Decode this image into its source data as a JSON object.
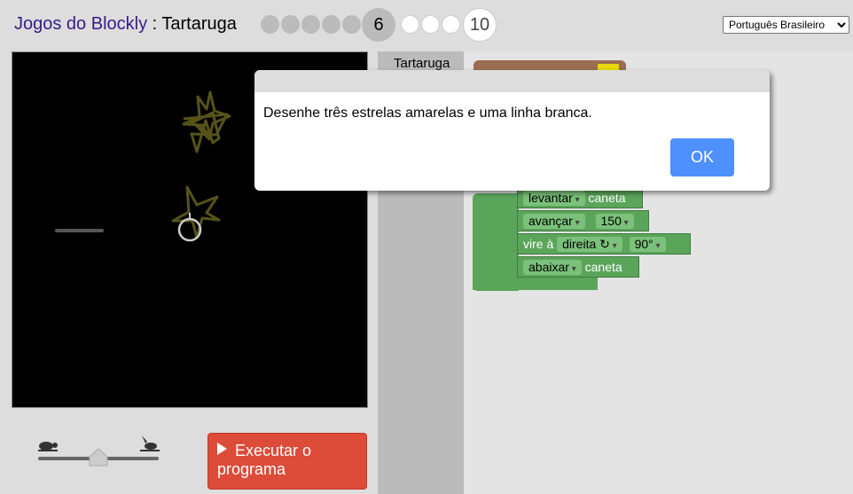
{
  "header": {
    "app_title": "Jogos do Blockly",
    "separator": " : ",
    "game_title": "Tartaruga",
    "current_level": "6",
    "last_level": "10"
  },
  "language": {
    "selected": "Português Brasileiro"
  },
  "toolbox": {
    "category": "Tartaruga"
  },
  "blocks": {
    "penup": {
      "dropdown": "levantar",
      "text": "caneta"
    },
    "forward": {
      "dropdown": "avançar",
      "value": "150"
    },
    "turn": {
      "label": "vire à",
      "dropdown": "direita ↻",
      "value": "90°"
    },
    "pendown": {
      "dropdown": "abaixar",
      "text": "caneta"
    }
  },
  "controls": {
    "run_label": "Executar o programa"
  },
  "dialog": {
    "message": "Desenhe três estrelas amarelas e uma linha branca.",
    "ok_label": "OK"
  },
  "colors": {
    "turtle_block": "#5ba55b",
    "run_button": "#dd4b39",
    "ok_button": "#4d90fe",
    "star": "#56521a",
    "title_link": "#361b8c"
  }
}
